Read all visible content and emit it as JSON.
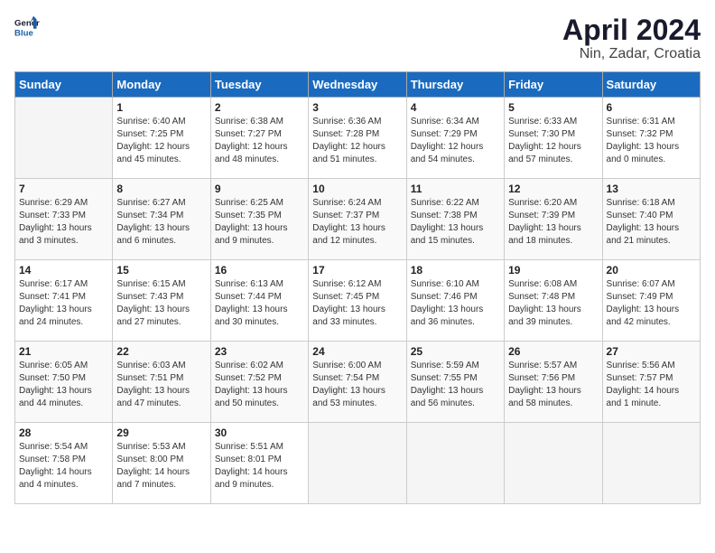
{
  "header": {
    "logo_general": "General",
    "logo_blue": "Blue",
    "title": "April 2024",
    "subtitle": "Nin, Zadar, Croatia"
  },
  "weekdays": [
    "Sunday",
    "Monday",
    "Tuesday",
    "Wednesday",
    "Thursday",
    "Friday",
    "Saturday"
  ],
  "weeks": [
    [
      {
        "day": "",
        "info": ""
      },
      {
        "day": "1",
        "info": "Sunrise: 6:40 AM\nSunset: 7:25 PM\nDaylight: 12 hours\nand 45 minutes."
      },
      {
        "day": "2",
        "info": "Sunrise: 6:38 AM\nSunset: 7:27 PM\nDaylight: 12 hours\nand 48 minutes."
      },
      {
        "day": "3",
        "info": "Sunrise: 6:36 AM\nSunset: 7:28 PM\nDaylight: 12 hours\nand 51 minutes."
      },
      {
        "day": "4",
        "info": "Sunrise: 6:34 AM\nSunset: 7:29 PM\nDaylight: 12 hours\nand 54 minutes."
      },
      {
        "day": "5",
        "info": "Sunrise: 6:33 AM\nSunset: 7:30 PM\nDaylight: 12 hours\nand 57 minutes."
      },
      {
        "day": "6",
        "info": "Sunrise: 6:31 AM\nSunset: 7:32 PM\nDaylight: 13 hours\nand 0 minutes."
      }
    ],
    [
      {
        "day": "7",
        "info": "Sunrise: 6:29 AM\nSunset: 7:33 PM\nDaylight: 13 hours\nand 3 minutes."
      },
      {
        "day": "8",
        "info": "Sunrise: 6:27 AM\nSunset: 7:34 PM\nDaylight: 13 hours\nand 6 minutes."
      },
      {
        "day": "9",
        "info": "Sunrise: 6:25 AM\nSunset: 7:35 PM\nDaylight: 13 hours\nand 9 minutes."
      },
      {
        "day": "10",
        "info": "Sunrise: 6:24 AM\nSunset: 7:37 PM\nDaylight: 13 hours\nand 12 minutes."
      },
      {
        "day": "11",
        "info": "Sunrise: 6:22 AM\nSunset: 7:38 PM\nDaylight: 13 hours\nand 15 minutes."
      },
      {
        "day": "12",
        "info": "Sunrise: 6:20 AM\nSunset: 7:39 PM\nDaylight: 13 hours\nand 18 minutes."
      },
      {
        "day": "13",
        "info": "Sunrise: 6:18 AM\nSunset: 7:40 PM\nDaylight: 13 hours\nand 21 minutes."
      }
    ],
    [
      {
        "day": "14",
        "info": "Sunrise: 6:17 AM\nSunset: 7:41 PM\nDaylight: 13 hours\nand 24 minutes."
      },
      {
        "day": "15",
        "info": "Sunrise: 6:15 AM\nSunset: 7:43 PM\nDaylight: 13 hours\nand 27 minutes."
      },
      {
        "day": "16",
        "info": "Sunrise: 6:13 AM\nSunset: 7:44 PM\nDaylight: 13 hours\nand 30 minutes."
      },
      {
        "day": "17",
        "info": "Sunrise: 6:12 AM\nSunset: 7:45 PM\nDaylight: 13 hours\nand 33 minutes."
      },
      {
        "day": "18",
        "info": "Sunrise: 6:10 AM\nSunset: 7:46 PM\nDaylight: 13 hours\nand 36 minutes."
      },
      {
        "day": "19",
        "info": "Sunrise: 6:08 AM\nSunset: 7:48 PM\nDaylight: 13 hours\nand 39 minutes."
      },
      {
        "day": "20",
        "info": "Sunrise: 6:07 AM\nSunset: 7:49 PM\nDaylight: 13 hours\nand 42 minutes."
      }
    ],
    [
      {
        "day": "21",
        "info": "Sunrise: 6:05 AM\nSunset: 7:50 PM\nDaylight: 13 hours\nand 44 minutes."
      },
      {
        "day": "22",
        "info": "Sunrise: 6:03 AM\nSunset: 7:51 PM\nDaylight: 13 hours\nand 47 minutes."
      },
      {
        "day": "23",
        "info": "Sunrise: 6:02 AM\nSunset: 7:52 PM\nDaylight: 13 hours\nand 50 minutes."
      },
      {
        "day": "24",
        "info": "Sunrise: 6:00 AM\nSunset: 7:54 PM\nDaylight: 13 hours\nand 53 minutes."
      },
      {
        "day": "25",
        "info": "Sunrise: 5:59 AM\nSunset: 7:55 PM\nDaylight: 13 hours\nand 56 minutes."
      },
      {
        "day": "26",
        "info": "Sunrise: 5:57 AM\nSunset: 7:56 PM\nDaylight: 13 hours\nand 58 minutes."
      },
      {
        "day": "27",
        "info": "Sunrise: 5:56 AM\nSunset: 7:57 PM\nDaylight: 14 hours\nand 1 minute."
      }
    ],
    [
      {
        "day": "28",
        "info": "Sunrise: 5:54 AM\nSunset: 7:58 PM\nDaylight: 14 hours\nand 4 minutes."
      },
      {
        "day": "29",
        "info": "Sunrise: 5:53 AM\nSunset: 8:00 PM\nDaylight: 14 hours\nand 7 minutes."
      },
      {
        "day": "30",
        "info": "Sunrise: 5:51 AM\nSunset: 8:01 PM\nDaylight: 14 hours\nand 9 minutes."
      },
      {
        "day": "",
        "info": ""
      },
      {
        "day": "",
        "info": ""
      },
      {
        "day": "",
        "info": ""
      },
      {
        "day": "",
        "info": ""
      }
    ]
  ]
}
